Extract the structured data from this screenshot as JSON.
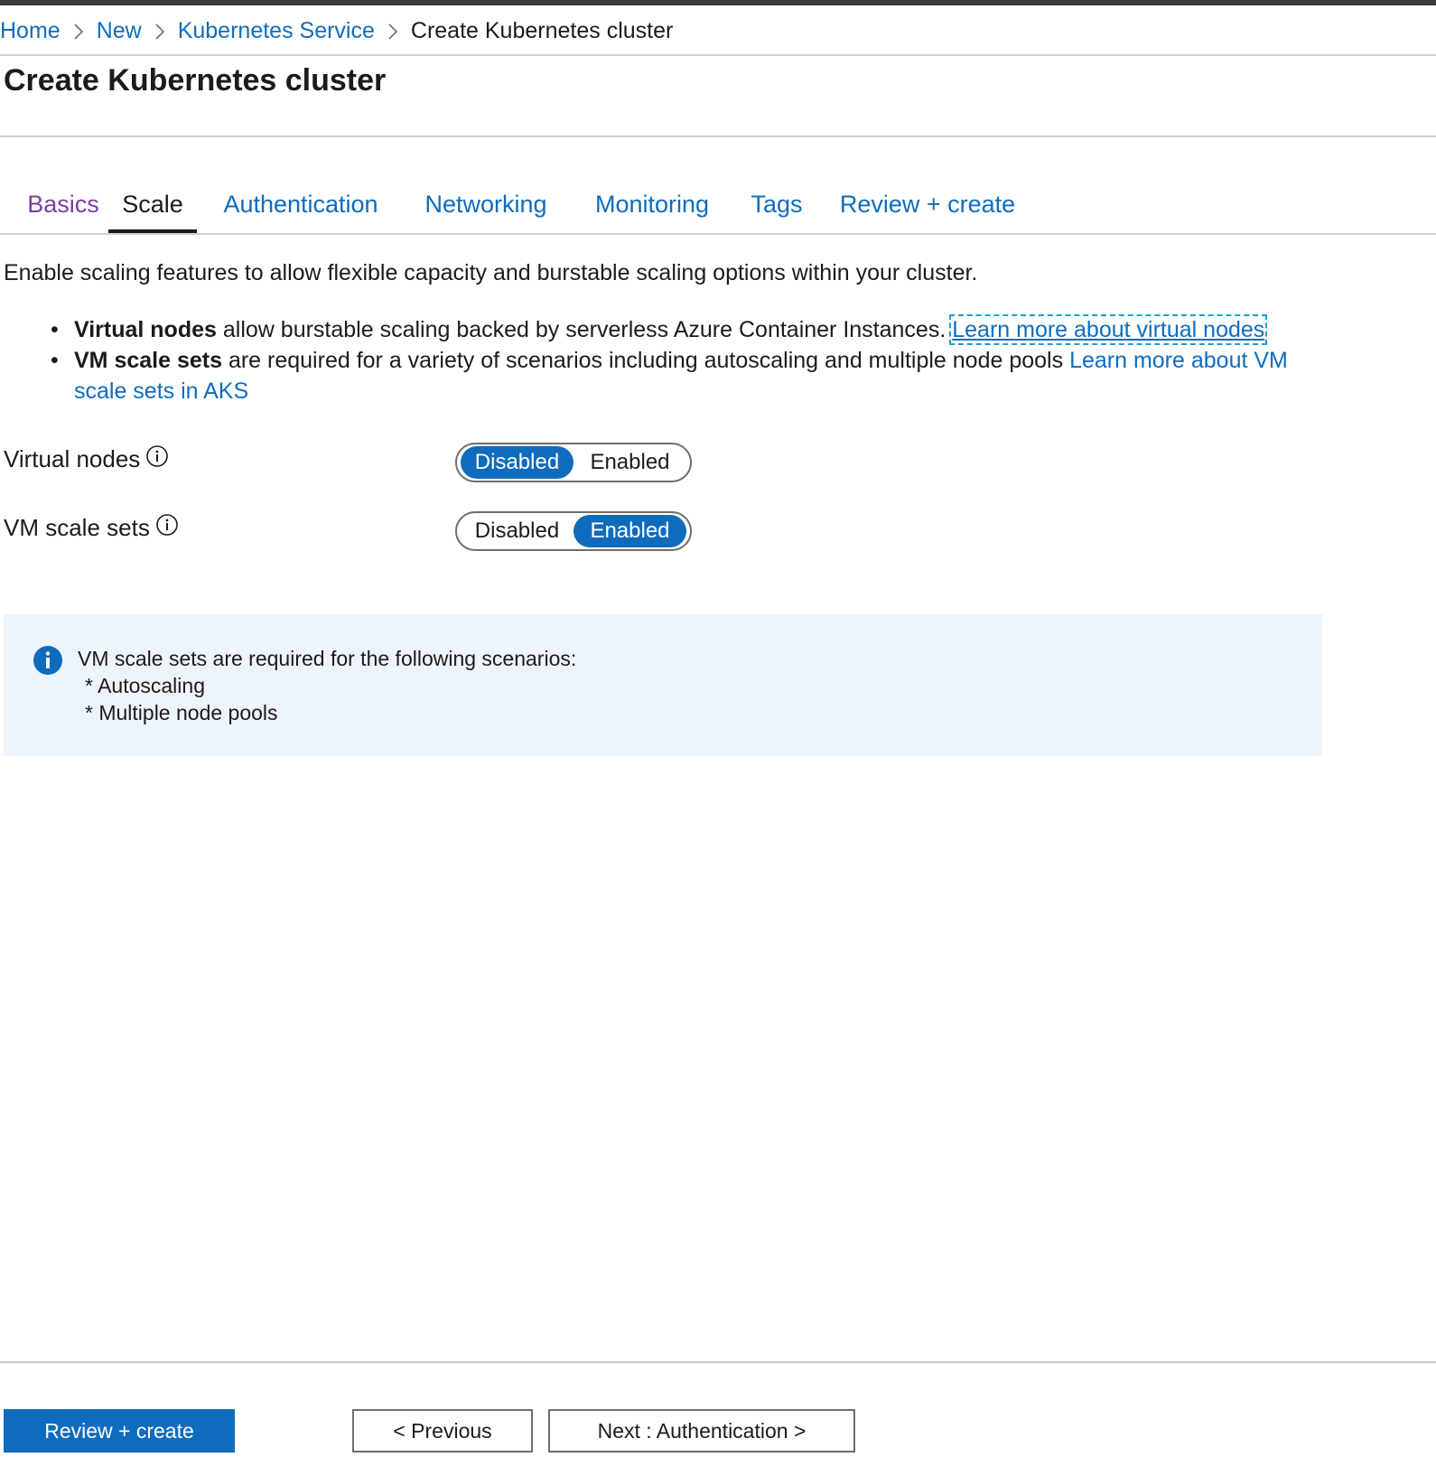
{
  "breadcrumb": {
    "items": [
      {
        "label": "Home"
      },
      {
        "label": "New"
      },
      {
        "label": "Kubernetes Service"
      }
    ],
    "current": "Create Kubernetes cluster"
  },
  "page": {
    "title": "Create Kubernetes cluster"
  },
  "tabs": [
    {
      "label": "Basics",
      "state": "visited"
    },
    {
      "label": "Scale",
      "state": "active"
    },
    {
      "label": "Authentication",
      "state": "default"
    },
    {
      "label": "Networking",
      "state": "default"
    },
    {
      "label": "Monitoring",
      "state": "default"
    },
    {
      "label": "Tags",
      "state": "default"
    },
    {
      "label": "Review + create",
      "state": "default"
    }
  ],
  "intro": "Enable scaling features to allow flexible capacity and burstable scaling options within your cluster.",
  "bullets": {
    "virtual_nodes": {
      "bold": "Virtual nodes",
      "text": " allow burstable scaling backed by serverless Azure Container Instances. ",
      "link": "Learn more about virtual nodes"
    },
    "vm_scale_sets": {
      "bold": "VM scale sets",
      "text": " are required for a variety of scenarios including autoscaling and multiple node pools ",
      "link": "Learn more about VM scale sets in AKS"
    }
  },
  "fields": {
    "virtual_nodes": {
      "label": "Virtual nodes",
      "options": [
        "Disabled",
        "Enabled"
      ],
      "selected": "Disabled"
    },
    "vm_scale_sets": {
      "label": "VM scale sets",
      "options": [
        "Disabled",
        "Enabled"
      ],
      "selected": "Enabled"
    }
  },
  "info_box": {
    "line1": "VM scale sets are required for the following scenarios:",
    "line2": "* Autoscaling",
    "line3": "* Multiple node pools"
  },
  "footer": {
    "review_create": "Review + create",
    "previous": "< Previous",
    "next": "Next : Authentication >"
  },
  "colors": {
    "accent": "#0f6cbd",
    "visited_tab": "#7b3fa0",
    "info_bg": "#eef4fb"
  }
}
